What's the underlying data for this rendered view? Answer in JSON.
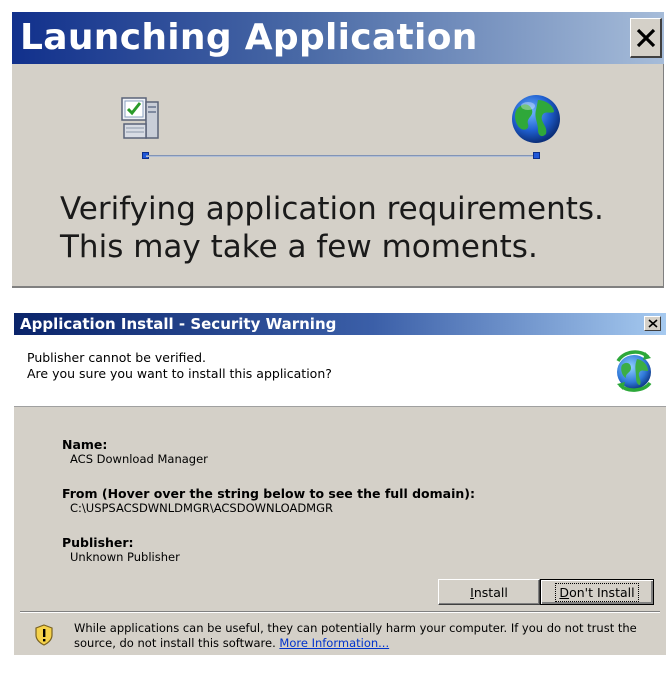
{
  "launching_dialog": {
    "title": "Launching Application",
    "close_glyph": "✕",
    "message": "Verifying application requirements. This may take a few moments.",
    "left_icon": "computer-check-icon",
    "right_icon": "globe-icon"
  },
  "security_dialog": {
    "title": "Application Install - Security Warning",
    "close_glyph": "✕",
    "header": {
      "line1": "Publisher cannot be verified.",
      "line2": "Are you sure you want to install this application?",
      "icon": "globe-arrows-icon"
    },
    "fields": {
      "name_label": "Name:",
      "name_value": "ACS Download Manager",
      "from_label": "From (Hover over the string below to see the full domain):",
      "from_value": "C:\\USPSACSDWNLDMGR\\ACSDOWNLOADMGR",
      "publisher_label": "Publisher:",
      "publisher_value": "Unknown Publisher"
    },
    "buttons": {
      "install_prefix": "",
      "install_mnemonic": "I",
      "install_rest": "nstall",
      "dont_prefix": "",
      "dont_mnemonic": "D",
      "dont_rest": "on't Install"
    },
    "footer": {
      "text": "While applications can be useful, they can potentially harm your computer. If you do not trust the source, do not install this software. ",
      "link": "More Information...",
      "icon": "shield-warning-icon"
    }
  },
  "colors": {
    "launch_titlebar_start": "#11308c",
    "warn_titlebar_start": "#0a246a",
    "dialog_face": "#d4d0c8",
    "link": "#0033cc"
  }
}
